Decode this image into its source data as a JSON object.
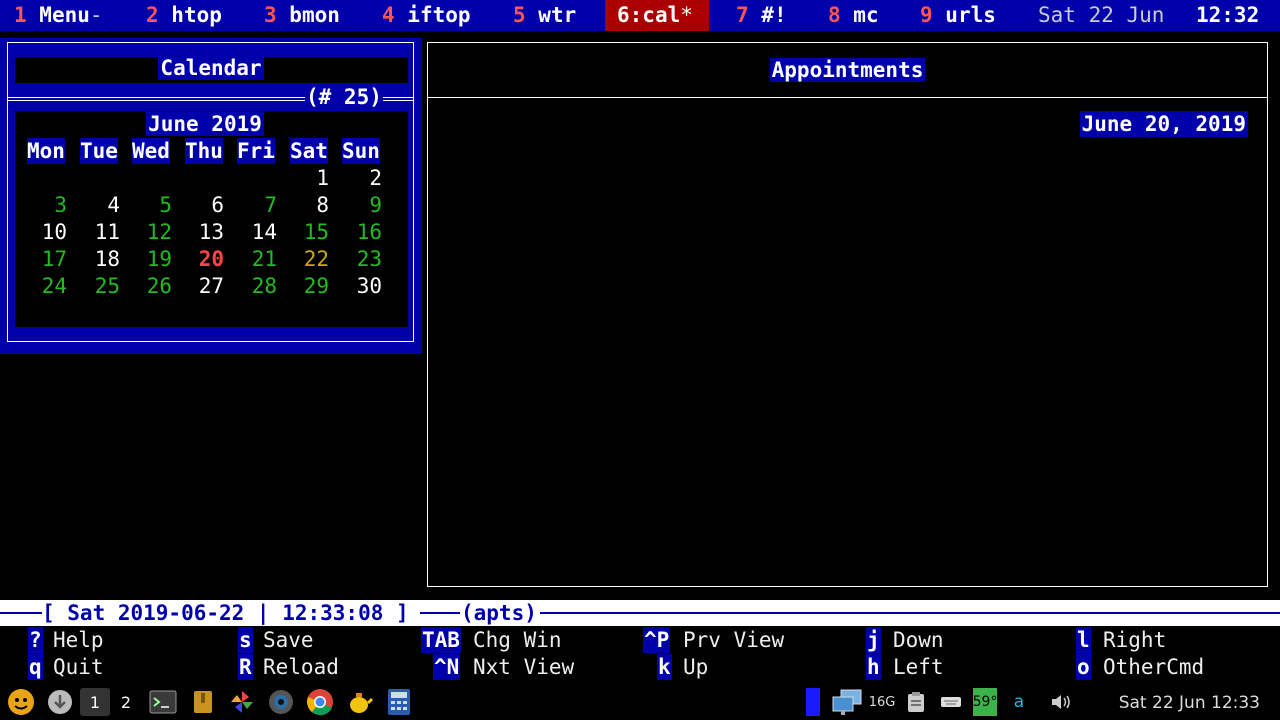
{
  "topbar": {
    "tabs": [
      {
        "num": "1",
        "label": "Menu",
        "flag": "-",
        "active": false
      },
      {
        "num": "2",
        "label": "htop",
        "flag": "",
        "active": false
      },
      {
        "num": "3",
        "label": "bmon",
        "flag": "",
        "active": false
      },
      {
        "num": "4",
        "label": "iftop",
        "flag": "",
        "active": false
      },
      {
        "num": "5",
        "label": "wtr",
        "flag": "",
        "active": false
      },
      {
        "num": "6",
        "label": "cal",
        "flag": "*",
        "active": true
      },
      {
        "num": "7",
        "label": "#!",
        "flag": "",
        "active": false
      },
      {
        "num": "8",
        "label": "mc",
        "flag": "",
        "active": false
      },
      {
        "num": "9",
        "label": "urls",
        "flag": "",
        "active": false
      }
    ],
    "date": "Sat 22 Jun",
    "time": "12:32"
  },
  "calendar": {
    "title": "Calendar",
    "week": "(# 25)",
    "month": "June 2019",
    "weekdays": [
      "Mon",
      "Tue",
      "Wed",
      "Thu",
      "Fri",
      "Sat",
      "Sun"
    ],
    "weeks": [
      [
        {
          "d": ""
        },
        {
          "d": ""
        },
        {
          "d": ""
        },
        {
          "d": ""
        },
        {
          "d": ""
        },
        {
          "d": "1",
          "c": "white"
        },
        {
          "d": "2",
          "c": "white"
        }
      ],
      [
        {
          "d": "3",
          "c": "green"
        },
        {
          "d": "4",
          "c": "white"
        },
        {
          "d": "5",
          "c": "green"
        },
        {
          "d": "6",
          "c": "white"
        },
        {
          "d": "7",
          "c": "green"
        },
        {
          "d": "8",
          "c": "white"
        },
        {
          "d": "9",
          "c": "green"
        }
      ],
      [
        {
          "d": "10",
          "c": "white"
        },
        {
          "d": "11",
          "c": "white"
        },
        {
          "d": "12",
          "c": "green"
        },
        {
          "d": "13",
          "c": "white"
        },
        {
          "d": "14",
          "c": "white"
        },
        {
          "d": "15",
          "c": "green"
        },
        {
          "d": "16",
          "c": "green"
        }
      ],
      [
        {
          "d": "17",
          "c": "green"
        },
        {
          "d": "18",
          "c": "white"
        },
        {
          "d": "19",
          "c": "green"
        },
        {
          "d": "20",
          "c": "red"
        },
        {
          "d": "21",
          "c": "green"
        },
        {
          "d": "22",
          "c": "yellow"
        },
        {
          "d": "23",
          "c": "green"
        }
      ],
      [
        {
          "d": "24",
          "c": "green"
        },
        {
          "d": "25",
          "c": "green"
        },
        {
          "d": "26",
          "c": "green"
        },
        {
          "d": "27",
          "c": "white"
        },
        {
          "d": "28",
          "c": "green"
        },
        {
          "d": "29",
          "c": "green"
        },
        {
          "d": "30",
          "c": "white"
        }
      ]
    ],
    "colors": {
      "white": "#ffffff",
      "green": "#22bb22",
      "red": "#ff4444",
      "yellow": "#ccaa00"
    }
  },
  "appointments": {
    "title": "Appointments",
    "date": "June 20, 2019"
  },
  "status": {
    "text": "[ Sat 2019-06-22 | 12:33:08 ]",
    "view": "(apts)"
  },
  "keys": [
    {
      "k": "?",
      "desc": "Help"
    },
    {
      "k": "q",
      "desc": "Quit"
    },
    {
      "k": "s",
      "desc": "Save"
    },
    {
      "k": "R",
      "desc": "Reload"
    },
    {
      "k": "TAB",
      "desc": "Chg Win"
    },
    {
      "k": "^N",
      "desc": "Nxt View"
    },
    {
      "k": "^P",
      "desc": "Prv View"
    },
    {
      "k": "k",
      "desc": "Up"
    },
    {
      "k": "j",
      "desc": "Down"
    },
    {
      "k": "h",
      "desc": "Left"
    },
    {
      "k": "l",
      "desc": "Right"
    },
    {
      "k": "o",
      "desc": "OtherCmd"
    }
  ],
  "taskbar": {
    "workspaces": [
      "1",
      "2"
    ],
    "tray": {
      "memory": "16G",
      "temp": "59°",
      "letter": "a"
    },
    "clock": "Sat 22 Jun 12:33"
  }
}
